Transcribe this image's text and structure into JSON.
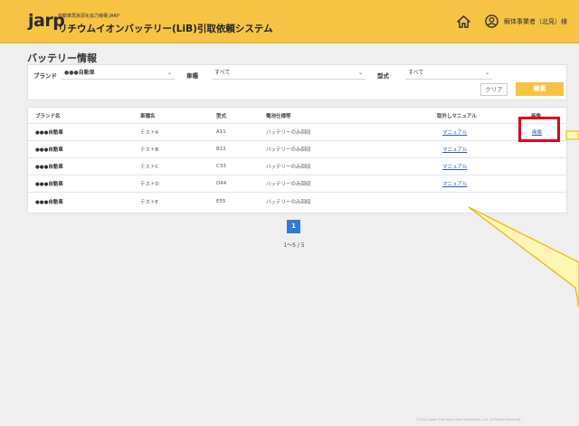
{
  "header": {
    "logo": "jarp",
    "logo_sub": "",
    "org_name": "自動車再資源化協力機構 JARP",
    "system_title": "リチウムイオンバッテリー(LiB)引取依頼システム",
    "user_name": "解体事業者（北見）様"
  },
  "page": {
    "title": "バッテリー情報"
  },
  "filters": {
    "brand_label": "ブランド",
    "brand_value": "●●●自動車",
    "model_label": "車種",
    "model_value": "すべて",
    "type_label": "型式",
    "type_value": "すべて",
    "clear_label": "クリア",
    "search_label": "検索"
  },
  "table": {
    "headers": {
      "brand": "ブランド名",
      "model": "車種名",
      "type": "型式",
      "spec": "電池仕様等",
      "manual": "取外しマニュアル",
      "image": "画像"
    },
    "rows": [
      {
        "brand": "●●●自動車",
        "model": "テストA",
        "type": "A11",
        "spec": "バッテリーのみ回収",
        "manual": "マニュアル",
        "image": "画像"
      },
      {
        "brand": "●●●自動車",
        "model": "テストB",
        "type": "B22",
        "spec": "バッテリーのみ回収",
        "manual": "マニュアル",
        "image": ""
      },
      {
        "brand": "●●●自動車",
        "model": "テストC",
        "type": "C33",
        "spec": "バッテリーのみ回収",
        "manual": "マニュアル",
        "image": ""
      },
      {
        "brand": "●●●自動車",
        "model": "テストD",
        "type": "D44",
        "spec": "バッテリーのみ回収",
        "manual": "マニュアル",
        "image": ""
      },
      {
        "brand": "●●●自動車",
        "model": "テストE",
        "type": "E55",
        "spec": "バッテリーのみ回収",
        "manual": "",
        "image": ""
      }
    ]
  },
  "pagination": {
    "current_page": "1",
    "range_text": "1〜5 / 5"
  },
  "footer": {
    "copyright": "©2021 Japan Auto Recycling Partnership, Ltd. All Rights Reserved."
  },
  "colors": {
    "header_bg": "#f6c343",
    "link": "#2a5fb0",
    "page_active": "#2f7bde",
    "highlight": "#e2001a",
    "callout_fill": "#fff6b3",
    "callout_stroke": "#e6b800"
  },
  "icons": {
    "home": "home-icon",
    "user": "user-circle-icon"
  }
}
